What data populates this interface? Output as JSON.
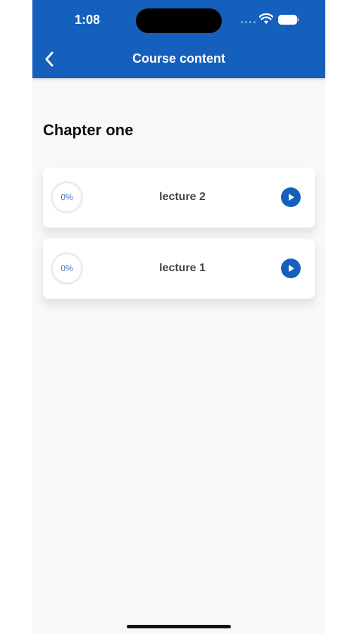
{
  "status_bar": {
    "time": "1:08"
  },
  "header": {
    "title": "Course content",
    "back_icon": "chevron-left-icon"
  },
  "chapter": {
    "title": "Chapter one",
    "lectures": [
      {
        "title": "lecture 2",
        "progress_label": "0%",
        "progress": 0,
        "action_icon": "play-icon"
      },
      {
        "title": "lecture 1",
        "progress_label": "0%",
        "progress": 0,
        "action_icon": "play-icon"
      }
    ]
  },
  "colors": {
    "primary": "#1560bd",
    "background": "#f8f8f9",
    "card": "#ffffff",
    "progress_text": "#3a6fb8"
  }
}
